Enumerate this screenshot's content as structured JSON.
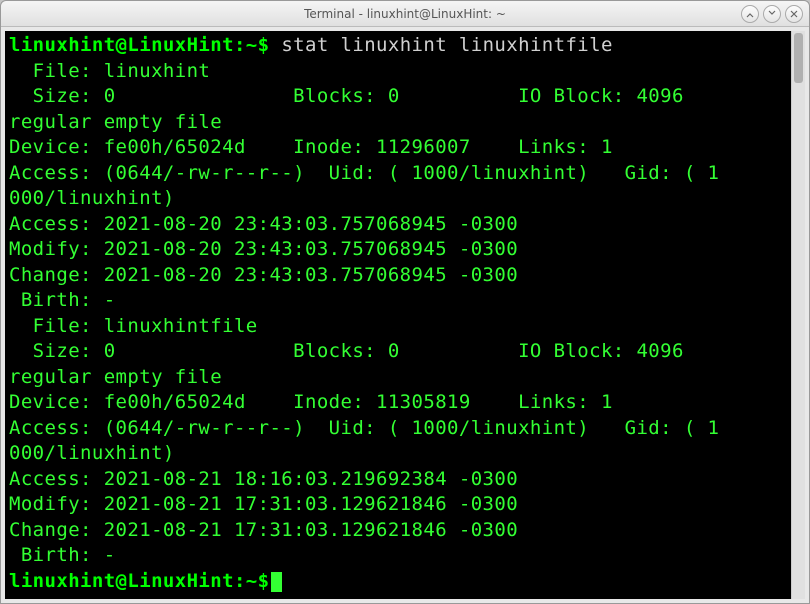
{
  "window": {
    "title": "Terminal - linuxhint@LinuxHint: ~"
  },
  "prompt": {
    "userhost": "linuxhint@LinuxHint",
    "sep1": ":",
    "path": "~",
    "sep2": "$"
  },
  "command": "stat linuxhint linuxhintfile",
  "lines": {
    "l01": "  File: linuxhint",
    "l02": "  Size: 0               Blocks: 0          IO Block: 4096",
    "l03": "regular empty file",
    "l04": "Device: fe00h/65024d    Inode: 11296007    Links: 1",
    "l05": "Access: (0644/-rw-r--r--)  Uid: ( 1000/linuxhint)   Gid: ( 1",
    "l06": "000/linuxhint)",
    "l07": "Access: 2021-08-20 23:43:03.757068945 -0300",
    "l08": "Modify: 2021-08-20 23:43:03.757068945 -0300",
    "l09": "Change: 2021-08-20 23:43:03.757068945 -0300",
    "l10": " Birth: -",
    "l11": "  File: linuxhintfile",
    "l12": "  Size: 0               Blocks: 0          IO Block: 4096",
    "l13": "regular empty file",
    "l14": "Device: fe00h/65024d    Inode: 11305819    Links: 1",
    "l15": "Access: (0644/-rw-r--r--)  Uid: ( 1000/linuxhint)   Gid: ( 1",
    "l16": "000/linuxhint)",
    "l17": "Access: 2021-08-21 18:16:03.219692384 -0300",
    "l18": "Modify: 2021-08-21 17:31:03.129621846 -0300",
    "l19": "Change: 2021-08-21 17:31:03.129621846 -0300",
    "l20": " Birth: -"
  }
}
